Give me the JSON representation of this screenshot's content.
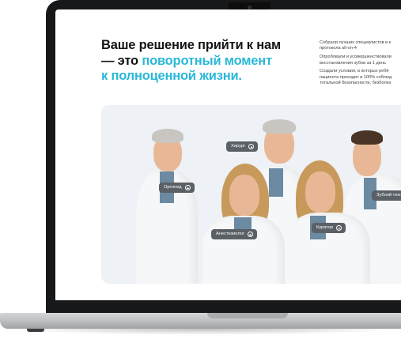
{
  "hero": {
    "headline_line1": "Ваше решение прийти к нам",
    "headline_line2_plain": "— это ",
    "headline_line2_accent": "поворотный момент",
    "headline_line3_accent": "к полноценной жизни.",
    "accent_color": "#29b8d8"
  },
  "side_text": {
    "p1_line1": "Собрали лучших специалистов в к",
    "p1_line2": "протокола all-on-4",
    "p2_line1": "Опробовали и усовершенствовали",
    "p2_line2": "восстановления зубов за 1 день",
    "p3_line1": "Создали условия, в которых ребё",
    "p3_line2": "пациента проходит в 100% соблюд",
    "p3_line3": "тотальной безопасности, безболез"
  },
  "team_tags": {
    "surgeon": "Хирург",
    "orthopedist": "Ортопед",
    "anesthesiologist": "Анестезиолог",
    "curator": "Куратор",
    "dental_tech": "Зубной техн"
  },
  "icons": {
    "tag_icon": "plus-circle-icon"
  }
}
